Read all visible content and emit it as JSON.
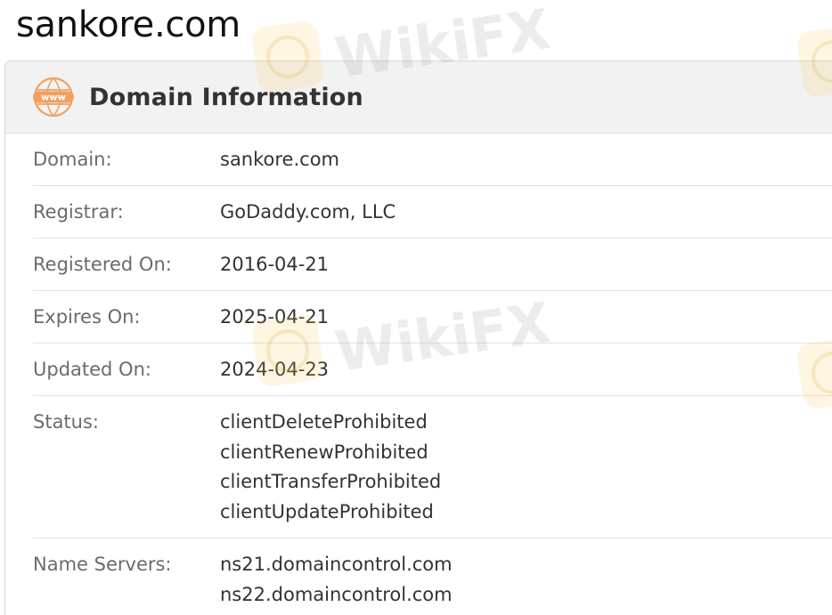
{
  "page_title": "sankore.com",
  "card": {
    "title": "Domain Information",
    "icon": "www-icon",
    "accent_color": "#f0a060"
  },
  "rows": [
    {
      "label": "Domain:",
      "values": [
        "sankore.com"
      ]
    },
    {
      "label": "Registrar:",
      "values": [
        "GoDaddy.com, LLC"
      ]
    },
    {
      "label": "Registered On:",
      "values": [
        "2016-04-21"
      ]
    },
    {
      "label": "Expires On:",
      "values": [
        "2025-04-21"
      ]
    },
    {
      "label": "Updated On:",
      "values": [
        "2024-04-23"
      ]
    },
    {
      "label": "Status:",
      "values": [
        "clientDeleteProhibited",
        "clientRenewProhibited",
        "clientTransferProhibited",
        "clientUpdateProhibited"
      ]
    },
    {
      "label": "Name Servers:",
      "values": [
        "ns21.domaincontrol.com",
        "ns22.domaincontrol.com"
      ]
    }
  ],
  "watermark": {
    "text": "WikiFX"
  }
}
